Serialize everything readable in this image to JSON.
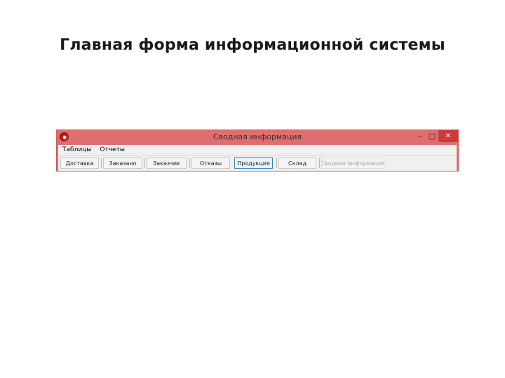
{
  "slide": {
    "title": "Главная форма информационной системы"
  },
  "window": {
    "title": "Сводная информация",
    "controls": {
      "minimize": "–",
      "maximize": "□",
      "close": "✕"
    }
  },
  "menu": {
    "items": [
      "Таблицы",
      "Отчеты"
    ]
  },
  "toolbar": {
    "buttons": [
      {
        "label": "Доставка"
      },
      {
        "label": "Заказано"
      },
      {
        "label": "Заказчик"
      },
      {
        "label": "Отказы"
      },
      {
        "label": "Продукция"
      },
      {
        "label": "Склад"
      },
      {
        "label": "Сводная информация"
      }
    ],
    "active_index": 4,
    "disabled_index": 6
  },
  "colors": {
    "titlebar": "#e06e6e",
    "close_button": "#cc3a3a",
    "active_button_border": "#3c7fb1"
  }
}
